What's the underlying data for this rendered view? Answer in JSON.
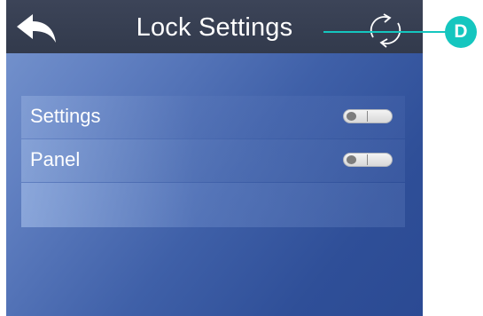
{
  "header": {
    "title": "Lock Settings",
    "back_icon": "back-arrow-icon",
    "refresh_icon": "refresh-icon"
  },
  "list": {
    "items": [
      {
        "label": "Settings",
        "toggle_on": false
      },
      {
        "label": "Panel",
        "toggle_on": false
      },
      {
        "label": ""
      }
    ]
  },
  "callout": {
    "label": "D",
    "color": "#15c6bf"
  },
  "colors": {
    "header_bg": "#363e50",
    "screen_accent": "#3f60a8",
    "text": "#ffffff"
  }
}
